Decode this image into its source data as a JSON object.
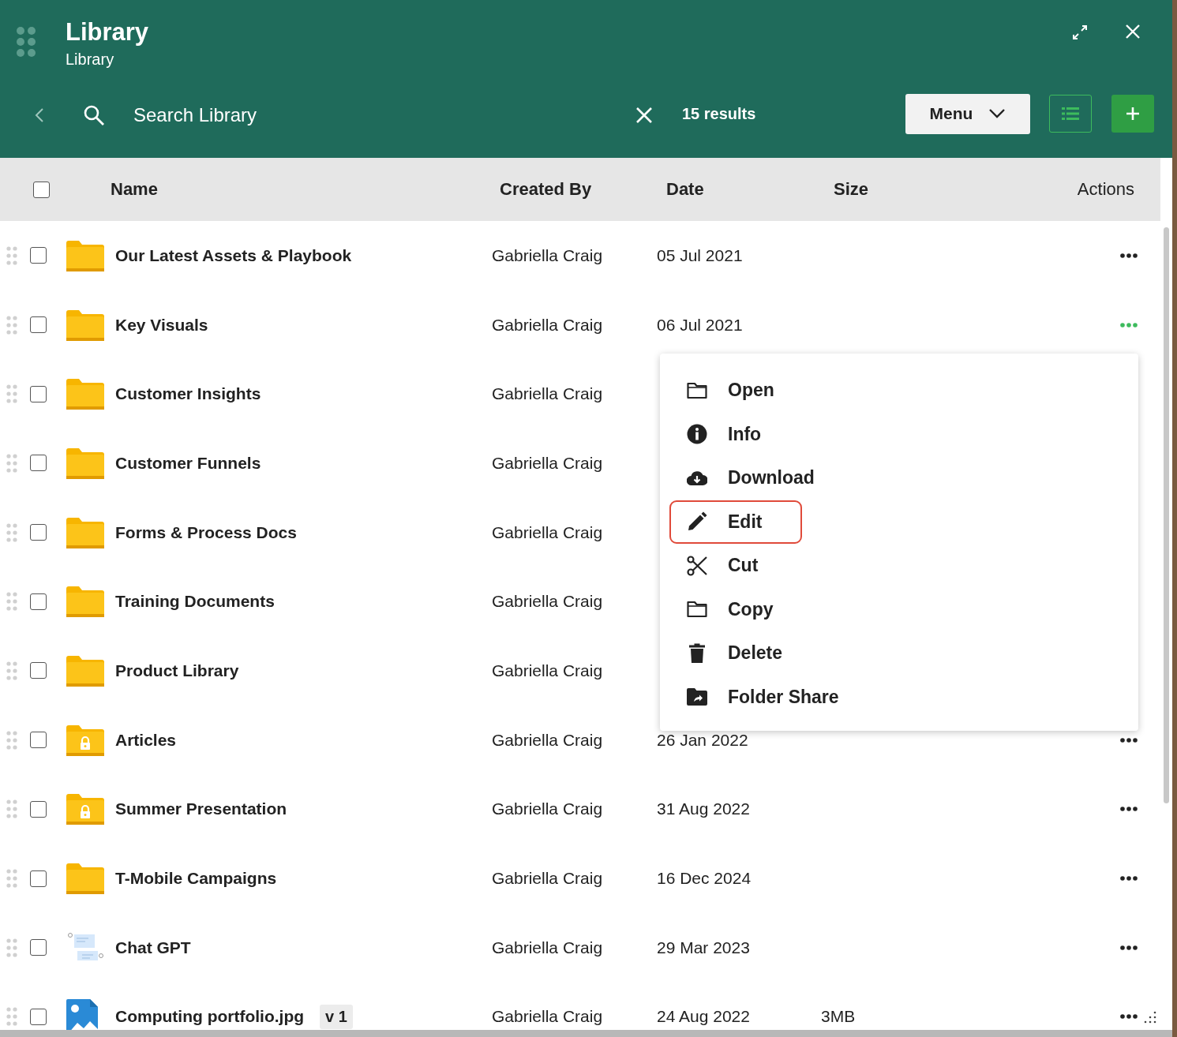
{
  "header": {
    "title": "Library",
    "subtitle": "Library"
  },
  "toolbar": {
    "search": {
      "placeholder": "Search Library"
    },
    "results": "15 results",
    "menu_button": "Menu"
  },
  "table": {
    "columns": [
      "Name",
      "Created By",
      "Date",
      "Size",
      "Actions"
    ],
    "all_checked": false,
    "rows": [
      {
        "kind": "folder",
        "name": "Our Latest Assets & Playbook",
        "created_by": "Gabriella Craig",
        "date": "05 Jul 2021",
        "checked": false,
        "active": false
      },
      {
        "kind": "folder",
        "name": "Key Visuals",
        "created_by": "Gabriella Craig",
        "date": "06 Jul 2021",
        "checked": false,
        "active": true
      },
      {
        "kind": "folder",
        "name": "Customer Insights",
        "created_by": "Gabriella Craig",
        "checked": false
      },
      {
        "kind": "folder",
        "name": "Customer Funnels",
        "created_by": "Gabriella Craig",
        "checked": false
      },
      {
        "kind": "folder",
        "name": "Forms & Process Docs",
        "created_by": "Gabriella Craig",
        "checked": false
      },
      {
        "kind": "folder",
        "name": "Training Documents",
        "created_by": "Gabriella Craig",
        "checked": false
      },
      {
        "kind": "folder",
        "name": "Product Library",
        "created_by": "Gabriella Craig",
        "checked": false
      },
      {
        "kind": "locked",
        "name": "Articles",
        "created_by": "Gabriella Craig",
        "date": "26 Jan 2022",
        "checked": false,
        "active": false
      },
      {
        "kind": "locked",
        "name": "Summer Presentation",
        "created_by": "Gabriella Craig",
        "date": "31 Aug 2022",
        "checked": false,
        "active": false
      },
      {
        "kind": "folder",
        "name": "T-Mobile Campaigns",
        "created_by": "Gabriella Craig",
        "date": "16 Dec 2024",
        "checked": false,
        "active": false
      },
      {
        "kind": "chat",
        "name": "Chat GPT",
        "created_by": "Gabriella Craig",
        "date": "29 Mar 2023",
        "checked": false,
        "active": false
      },
      {
        "kind": "image",
        "name": "Computing portfolio.jpg",
        "version": "v 1",
        "created_by": "Gabriella Craig",
        "date": "24 Aug 2022",
        "size": "3MB",
        "checked": false,
        "active": false
      }
    ]
  },
  "context_menu": {
    "items": [
      {
        "kind": "folder",
        "label": "Open",
        "selected": false
      },
      {
        "kind": "info",
        "label": "Info",
        "selected": false
      },
      {
        "kind": "download",
        "label": "Download",
        "selected": false
      },
      {
        "kind": "pencil",
        "label": "Edit",
        "selected": true
      },
      {
        "kind": "scissors",
        "label": "Cut",
        "selected": false
      },
      {
        "kind": "folder",
        "label": "Copy",
        "selected": false
      },
      {
        "kind": "trash",
        "label": "Delete",
        "selected": false
      },
      {
        "kind": "share",
        "label": "Folder Share",
        "selected": false
      }
    ]
  }
}
